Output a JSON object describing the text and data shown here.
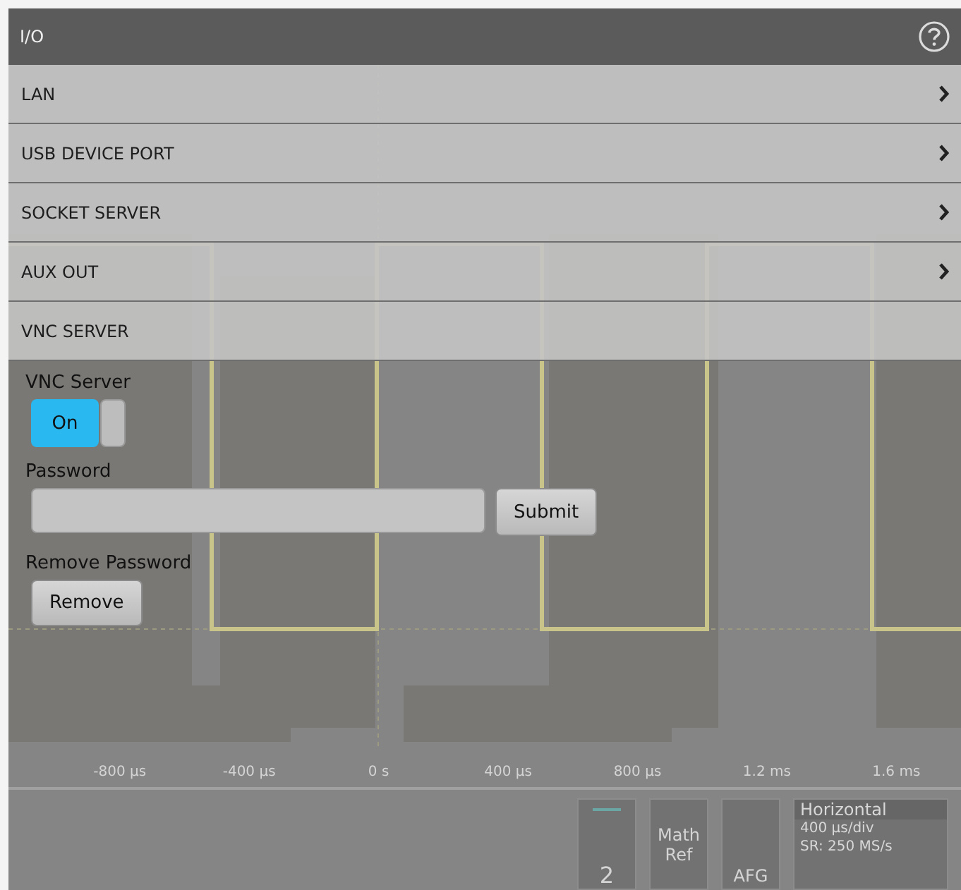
{
  "header": {
    "title": "I/O"
  },
  "menu": [
    {
      "label": "LAN",
      "has_submenu": true
    },
    {
      "label": "USB DEVICE PORT",
      "has_submenu": true
    },
    {
      "label": "SOCKET SERVER",
      "has_submenu": true
    },
    {
      "label": "AUX OUT",
      "has_submenu": true
    },
    {
      "label": "VNC SERVER",
      "has_submenu": false
    }
  ],
  "vnc": {
    "server_label": "VNC Server",
    "toggle": {
      "label": "On",
      "on": true
    },
    "password_label": "Password",
    "submit_button": "Submit",
    "remove_label": "Remove Password",
    "remove_button": "Remove"
  },
  "scope": {
    "time_axis": [
      "-800 µs",
      "-400 µs",
      "0 s",
      "400 µs",
      "800 µs",
      "1.2 ms",
      "1.6 ms"
    ],
    "channel_tab": "2",
    "math_ref": "Math Ref",
    "afg": "AFG",
    "horizontal": {
      "title": "Horizontal",
      "scale": "400 µs/div",
      "sample_rate": "SR: 250 MS/s"
    }
  }
}
